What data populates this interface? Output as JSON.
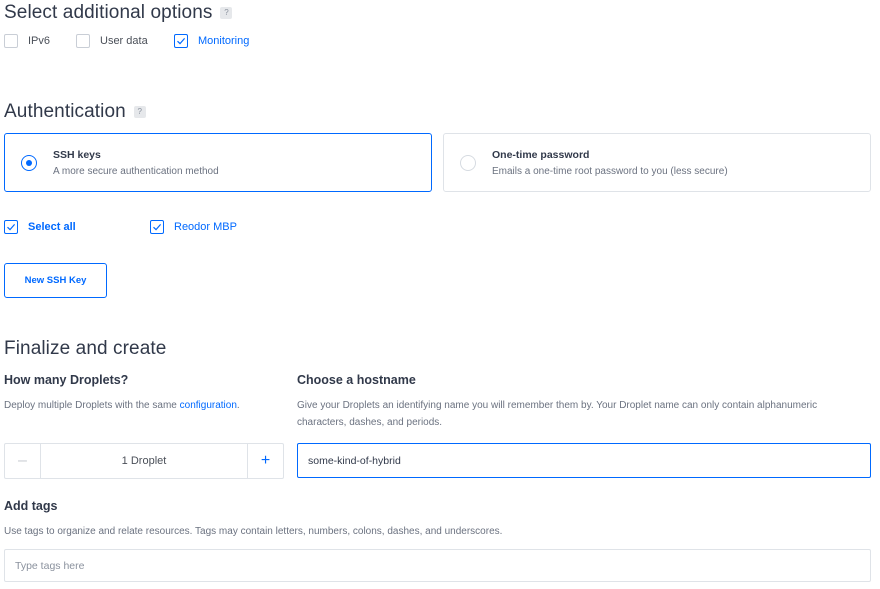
{
  "additional_options": {
    "title": "Select additional options",
    "help": "?",
    "options": [
      {
        "label": "IPv6",
        "checked": false
      },
      {
        "label": "User data",
        "checked": false
      },
      {
        "label": "Monitoring",
        "checked": true
      }
    ]
  },
  "authentication": {
    "title": "Authentication",
    "help": "?",
    "methods": [
      {
        "title": "SSH keys",
        "desc": "A more secure authentication method",
        "selected": true
      },
      {
        "title": "One-time password",
        "desc": "Emails a one-time root password to you (less secure)",
        "selected": false
      }
    ],
    "select_all_label": "Select all",
    "keys": [
      {
        "label": "Reodor MBP",
        "checked": true
      }
    ],
    "new_key_button": "New SSH Key"
  },
  "finalize": {
    "title": "Finalize and create",
    "droplets": {
      "heading": "How many Droplets?",
      "desc_prefix": "Deploy multiple Droplets with the same ",
      "desc_link": "configuration",
      "desc_suffix": ".",
      "minus": "–",
      "plus": "+",
      "value": "1 Droplet"
    },
    "hostname": {
      "heading": "Choose a hostname",
      "desc": "Give your Droplets an identifying name you will remember them by. Your Droplet name can only contain alphanumeric characters, dashes, and periods.",
      "value": "some-kind-of-hybrid"
    },
    "tags": {
      "heading": "Add tags",
      "desc": "Use tags to organize and relate resources. Tags may contain letters, numbers, colons, dashes, and underscores.",
      "placeholder": "Type tags here"
    }
  },
  "colors": {
    "accent": "#0069ff",
    "border": "#dfe3e8",
    "heading": "#31394a"
  }
}
